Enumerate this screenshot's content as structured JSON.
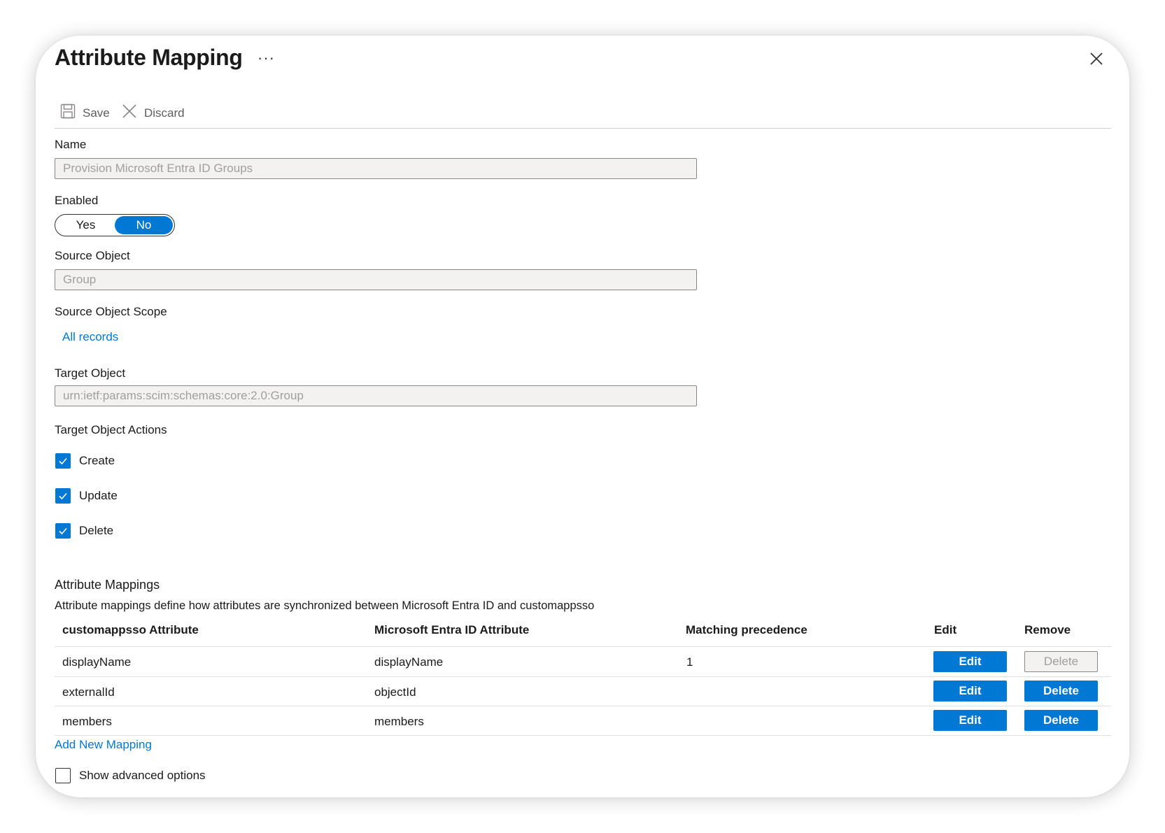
{
  "panel": {
    "title": "Attribute Mapping",
    "more_label": "···"
  },
  "toolbar": {
    "save_label": "Save",
    "discard_label": "Discard"
  },
  "form": {
    "name_label": "Name",
    "name_value": "Provision Microsoft Entra ID Groups",
    "enabled_label": "Enabled",
    "enabled_yes": "Yes",
    "enabled_no": "No",
    "enabled_selected": "No",
    "source_object_label": "Source Object",
    "source_object_value": "Group",
    "source_scope_label": "Source Object Scope",
    "source_scope_link": "All records",
    "target_object_label": "Target Object",
    "target_object_value": "urn:ietf:params:scim:schemas:core:2.0:Group",
    "target_actions_label": "Target Object Actions",
    "actions": [
      {
        "label": "Create",
        "checked": true
      },
      {
        "label": "Update",
        "checked": true
      },
      {
        "label": "Delete",
        "checked": true
      }
    ]
  },
  "mappings": {
    "title": "Attribute Mappings",
    "description": "Attribute mappings define how attributes are synchronized between Microsoft Entra ID and customappsso",
    "columns": [
      "customappsso Attribute",
      "Microsoft Entra ID Attribute",
      "Matching precedence",
      "Edit",
      "Remove"
    ],
    "rows": [
      {
        "target_attr": "displayName",
        "source_attr": "displayName",
        "precedence": "1",
        "edit_label": "Edit",
        "delete_label": "Delete",
        "delete_enabled": false
      },
      {
        "target_attr": "externalId",
        "source_attr": "objectId",
        "precedence": "",
        "edit_label": "Edit",
        "delete_label": "Delete",
        "delete_enabled": true
      },
      {
        "target_attr": "members",
        "source_attr": "members",
        "precedence": "",
        "edit_label": "Edit",
        "delete_label": "Delete",
        "delete_enabled": true
      }
    ],
    "add_link": "Add New Mapping"
  },
  "advanced": {
    "label": "Show advanced options",
    "checked": false
  },
  "colors": {
    "accent": "#0078d4",
    "disabled_bg": "#f3f2f1"
  }
}
